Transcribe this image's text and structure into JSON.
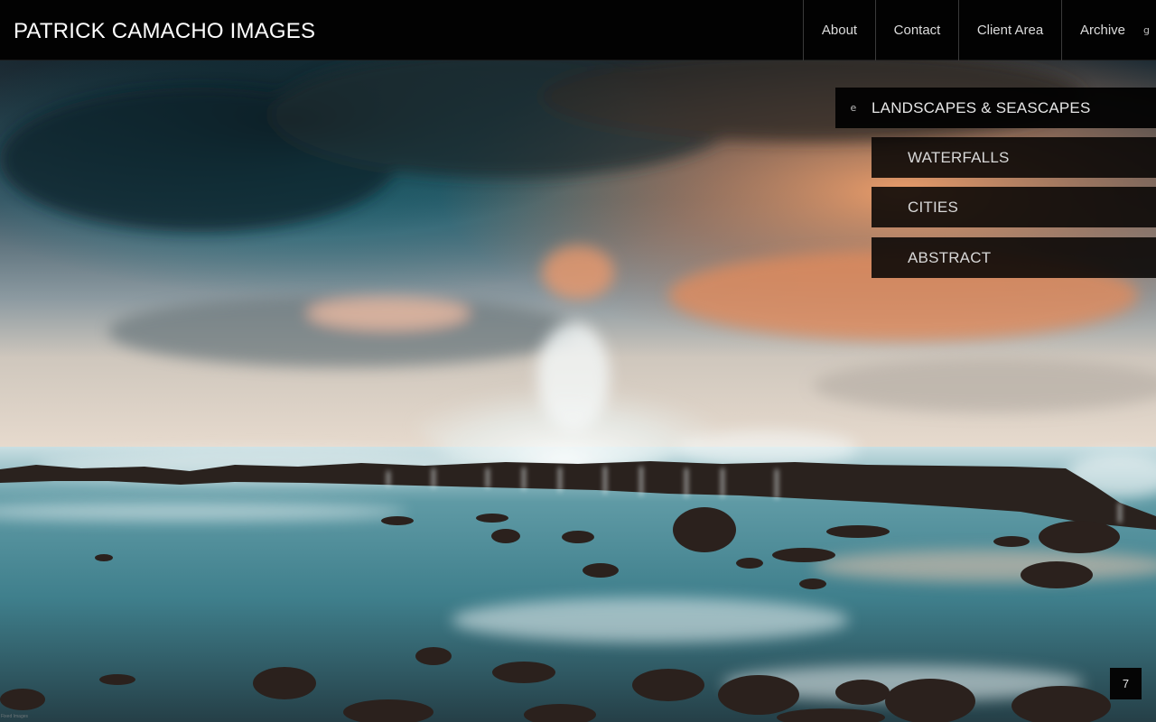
{
  "site": {
    "title": "PATRICK CAMACHO IMAGES"
  },
  "nav": {
    "items": [
      {
        "label": "About"
      },
      {
        "label": "Contact"
      },
      {
        "label": "Client Area"
      },
      {
        "label": "Archive",
        "icon_glyph": "g"
      }
    ]
  },
  "gallery_menu": {
    "active": {
      "label": "LANDSCAPES & SEASCAPES",
      "icon_glyph": "e"
    },
    "items": [
      {
        "label": "WATERFALLS"
      },
      {
        "label": "CITIES"
      },
      {
        "label": "ABSTRACT"
      }
    ]
  },
  "slideshow": {
    "counter": "7"
  },
  "footer": {
    "credit": "Fixed Images"
  },
  "colors": {
    "header_bg": "#020202",
    "menu_bg": "#080604",
    "text": "#dcdcdc"
  }
}
